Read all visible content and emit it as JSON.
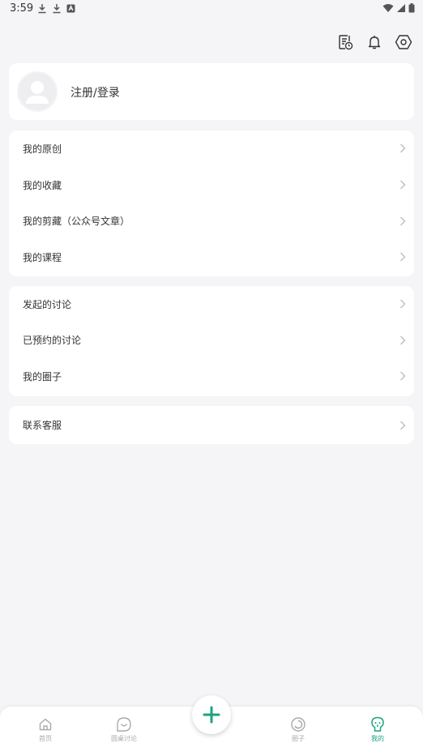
{
  "status_bar": {
    "time": "3:59"
  },
  "top_actions": {
    "icons": [
      "document-clock-icon",
      "bell-icon",
      "hexagon-settings-icon"
    ]
  },
  "profile": {
    "login_label": "注册/登录"
  },
  "menu_group_1": {
    "items": [
      "我的原创",
      "我的收藏",
      "我的剪藏（公众号文章）",
      "我的课程"
    ]
  },
  "menu_group_2": {
    "items": [
      "发起的讨论",
      "已预约的讨论",
      "我的圈子"
    ]
  },
  "menu_group_3": {
    "items": [
      "联系客服"
    ]
  },
  "bottom_nav": {
    "items": [
      {
        "label": "首页",
        "icon": "home-icon",
        "active": false
      },
      {
        "label": "圆桌讨论",
        "icon": "chat-smile-icon",
        "active": false
      },
      {
        "label": "圈子",
        "icon": "circle-ring-icon",
        "active": false
      },
      {
        "label": "我的",
        "icon": "lightbulb-face-icon",
        "active": true
      }
    ],
    "fab_icon": "plus-icon"
  },
  "colors": {
    "background": "#f5f5f7",
    "accent": "#1aa37f",
    "inactive": "#aaaaaa"
  }
}
